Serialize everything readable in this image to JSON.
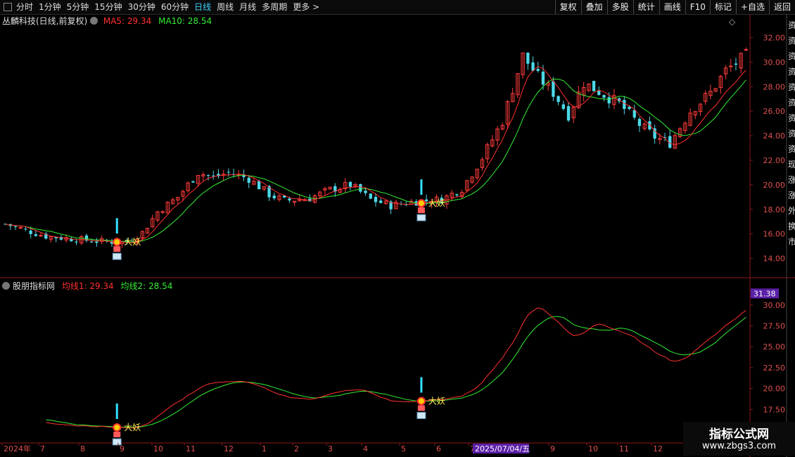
{
  "toolbar": {
    "periods": [
      "分时",
      "1分钟",
      "5分钟",
      "15分钟",
      "30分钟",
      "60分钟",
      "日线",
      "周线",
      "月线",
      "多周期",
      "更多 >"
    ],
    "active_period": "日线",
    "right_buttons": [
      "复权",
      "叠加",
      "多股",
      "统计",
      "画线",
      "F10",
      "标记",
      "+自选",
      "返回"
    ]
  },
  "main_chart": {
    "stock_title": "丛麟科技(日线,前复权)",
    "ma5_label": "MA5: 29.34",
    "ma10_label": "MA10: 28.54",
    "diamond_icon": "◇"
  },
  "indicator": {
    "name": "股朋指标网",
    "line1_label": "均线1: 29.34",
    "line2_label": "均线2: 28.54",
    "current_value": "31.38",
    "signal_text": "大妖"
  },
  "dates": {
    "highlight": "2025/07/04/五"
  },
  "watermark": {
    "line1": "指标公式网",
    "line2": "www.zbgs3.com"
  },
  "colors": {
    "up": "#ff3b3b",
    "down": "#4cd9e8",
    "ma5": "#ff3030",
    "ma10": "#33ee33",
    "signal_bar": "#33e0ff",
    "signal_text": "#ffee55",
    "highlight_bg": "#5b1fa8"
  },
  "chart_data": {
    "type": "candlestick",
    "price_axis": {
      "ticks": [
        32,
        30,
        28,
        26,
        24,
        22,
        20,
        18,
        16,
        14
      ],
      "range": [
        13,
        33
      ]
    },
    "indicator_axis": {
      "ticks": [
        30,
        27.5,
        25,
        22.5,
        20,
        17.5
      ],
      "range": [
        15,
        32
      ]
    },
    "x_ticks": [
      "2024年",
      "7",
      "8",
      "9",
      "10",
      "11",
      "12",
      "1",
      "2",
      "3",
      "4",
      "5",
      "6",
      "7",
      "9",
      "10",
      "11",
      "12",
      "2025/07/04/五"
    ],
    "ma5_last": 29.34,
    "ma10_last": 28.54,
    "signals": [
      {
        "label": "大妖",
        "date_index": 22
      },
      {
        "label": "大妖",
        "date_index": 82
      }
    ],
    "keyframes": [
      [
        0,
        16.8
      ],
      [
        8,
        15.8
      ],
      [
        18,
        15.4
      ],
      [
        24,
        15.3
      ],
      [
        27,
        16.1
      ],
      [
        30,
        17.8
      ],
      [
        34,
        19.0
      ],
      [
        38,
        21.0
      ],
      [
        41,
        20.6
      ],
      [
        44,
        21.0
      ],
      [
        48,
        20.5
      ],
      [
        52,
        19.2
      ],
      [
        55,
        18.7
      ],
      [
        60,
        18.9
      ],
      [
        64,
        19.6
      ],
      [
        68,
        20.0
      ],
      [
        72,
        18.8
      ],
      [
        76,
        18.3
      ],
      [
        80,
        18.6
      ],
      [
        86,
        18.8
      ],
      [
        90,
        19.7
      ],
      [
        94,
        22.2
      ],
      [
        98,
        25.2
      ],
      [
        102,
        30.5
      ],
      [
        105,
        28.8
      ],
      [
        108,
        27.5
      ],
      [
        111,
        25.7
      ],
      [
        114,
        28.3
      ],
      [
        117,
        27.6
      ],
      [
        121,
        26.6
      ],
      [
        125,
        24.9
      ],
      [
        128,
        23.9
      ],
      [
        131,
        23.4
      ],
      [
        135,
        26.0
      ],
      [
        139,
        27.5
      ],
      [
        142,
        29.3
      ],
      [
        146,
        30.5
      ]
    ]
  }
}
